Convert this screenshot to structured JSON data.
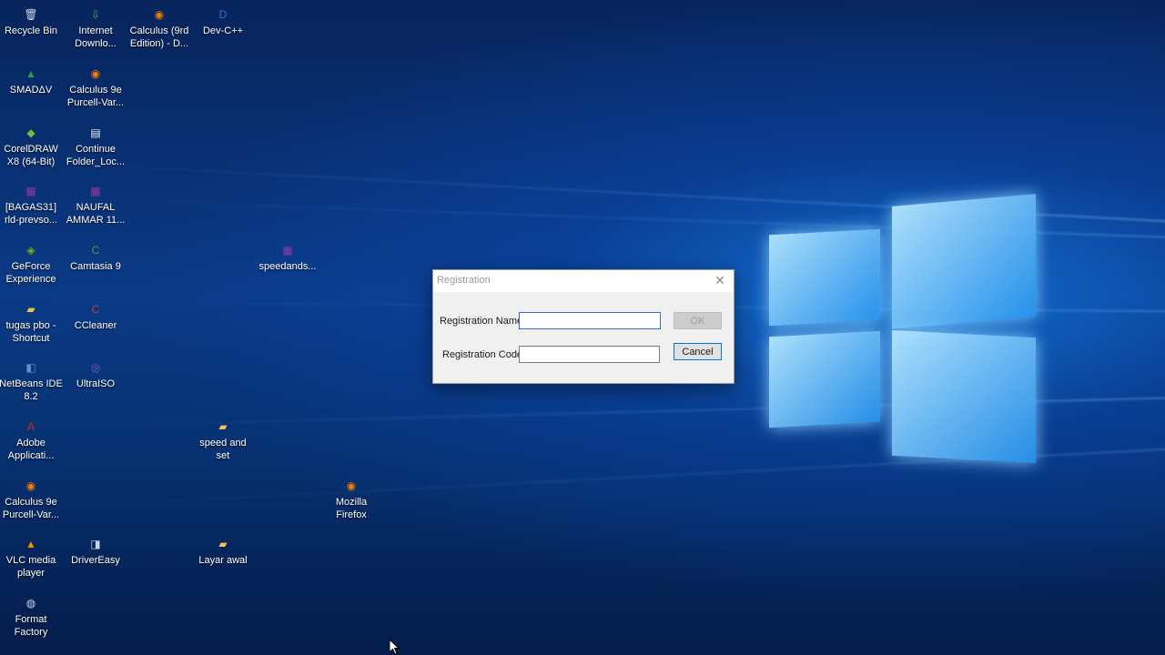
{
  "desktop": {
    "icons": [
      {
        "label": "Recycle Bin",
        "icon": "recycle-bin-icon",
        "glyph": "🗑",
        "color": "#c9d6e8"
      },
      {
        "label": "Internet\nDownlo...",
        "icon": "internet-download-manager-icon",
        "glyph": "⇩",
        "color": "#4caf50"
      },
      {
        "label": "Calculus (9rd\nEdition) - D...",
        "icon": "firefox-document-icon",
        "glyph": "◉",
        "color": "#f57c00"
      },
      {
        "label": "Dev-C++",
        "icon": "dev-cpp-icon",
        "glyph": "D",
        "color": "#3a6fc4"
      },
      {
        "label": "SMADΔV",
        "icon": "smadav-icon",
        "glyph": "▲",
        "color": "#2e9e3a"
      },
      {
        "label": "Calculus 9e\nPurcell-Var...",
        "icon": "firefox-document-icon",
        "glyph": "◉",
        "color": "#f57c00"
      },
      {
        "label": "CorelDRAW\nX8 (64-Bit)",
        "icon": "coreldraw-icon",
        "glyph": "◆",
        "color": "#6bbf3a"
      },
      {
        "label": "Continue\nFolder_Loc...",
        "icon": "document-icon",
        "glyph": "▤",
        "color": "#e8eef5"
      },
      {
        "label": "[BAGAS31]\nrld-prevso...",
        "icon": "winrar-archive-icon",
        "glyph": "▦",
        "color": "#8e3aa6"
      },
      {
        "label": "NAUFAL\nAMMAR 11...",
        "icon": "winrar-archive-icon",
        "glyph": "▦",
        "color": "#8e3aa6"
      },
      {
        "label": "GeForce\nExperience",
        "icon": "geforce-experience-icon",
        "glyph": "◈",
        "color": "#76b900"
      },
      {
        "label": "Camtasia 9",
        "icon": "camtasia-icon",
        "glyph": "C",
        "color": "#3aa64a"
      },
      {
        "label": "speedands...",
        "icon": "winrar-archive-icon",
        "glyph": "▦",
        "color": "#8e3aa6"
      },
      {
        "label": "tugas pbo -\nShortcut",
        "icon": "folder-shortcut-icon",
        "glyph": "▰",
        "color": "#f2c14e"
      },
      {
        "label": "CCleaner",
        "icon": "ccleaner-icon",
        "glyph": "C",
        "color": "#d9342b"
      },
      {
        "label": "NetBeans IDE\n8.2",
        "icon": "netbeans-icon",
        "glyph": "◧",
        "color": "#5b8fd6"
      },
      {
        "label": "UltraISO",
        "icon": "ultraiso-icon",
        "glyph": "◎",
        "color": "#7a5cc4"
      },
      {
        "label": "Adobe\nApplicati...",
        "icon": "adobe-icon",
        "glyph": "A",
        "color": "#d4261c"
      },
      {
        "label": "speed and\nset",
        "icon": "folder-icon",
        "glyph": "▰",
        "color": "#f2c14e"
      },
      {
        "label": "Calculus 9e\nPurcell-Var...",
        "icon": "firefox-document-icon",
        "glyph": "◉",
        "color": "#f57c00"
      },
      {
        "label": "Mozilla\nFirefox",
        "icon": "firefox-icon",
        "glyph": "◉",
        "color": "#f57c00"
      },
      {
        "label": "VLC media\nplayer",
        "icon": "vlc-icon",
        "glyph": "▲",
        "color": "#f39200"
      },
      {
        "label": "DriverEasy",
        "icon": "drivereasy-icon",
        "glyph": "◨",
        "color": "#c8d4e6"
      },
      {
        "label": "Layar awal",
        "icon": "folder-icon",
        "glyph": "▰",
        "color": "#f2c14e"
      },
      {
        "label": "Format\nFactory",
        "icon": "format-factory-icon",
        "glyph": "◍",
        "color": "#c8d4e6"
      }
    ]
  },
  "dialog": {
    "title": "Registration",
    "close_glyph": "✕",
    "name_label": "Registration Name:",
    "name_value": "",
    "code_label": "Registration Code:",
    "code_value": "",
    "ok_label": "OK",
    "cancel_label": "Cancel"
  }
}
